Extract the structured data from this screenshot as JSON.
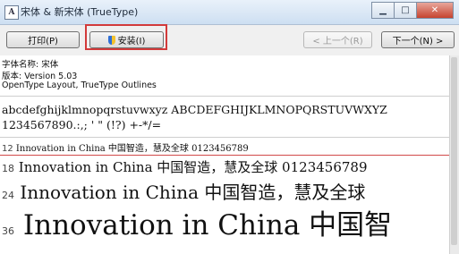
{
  "window": {
    "title": "宋体 & 新宋体 (TrueType)",
    "minimize": "▁",
    "maximize": "□",
    "close": "✕"
  },
  "toolbar": {
    "print": "打印(P)",
    "install": "安装(I)",
    "prev": "< 上一个(R)",
    "next": "下一个(N) >"
  },
  "info": {
    "name": "字体名称: 宋体",
    "version": "版本: Version 5.03",
    "outlines": "OpenType Layout, TrueType Outlines"
  },
  "charset": {
    "line1": "abcdefghijklmnopqrstuvwxyz ABCDEFGHIJKLMNOPQRSTUVWXYZ",
    "line2": "1234567890.:,; ' \" (!?) +-*/="
  },
  "samples": [
    {
      "size": "12",
      "text": "Innovation in China 中国智造，慧及全球 0123456789"
    },
    {
      "size": "18",
      "text": "Innovation in China 中国智造，慧及全球 0123456789"
    },
    {
      "size": "24",
      "text": "Innovation in China 中国智造，慧及全球"
    },
    {
      "size": "36",
      "text": "Innovation in China 中国智"
    }
  ],
  "colors": {
    "highlight": "#d23a3a"
  }
}
